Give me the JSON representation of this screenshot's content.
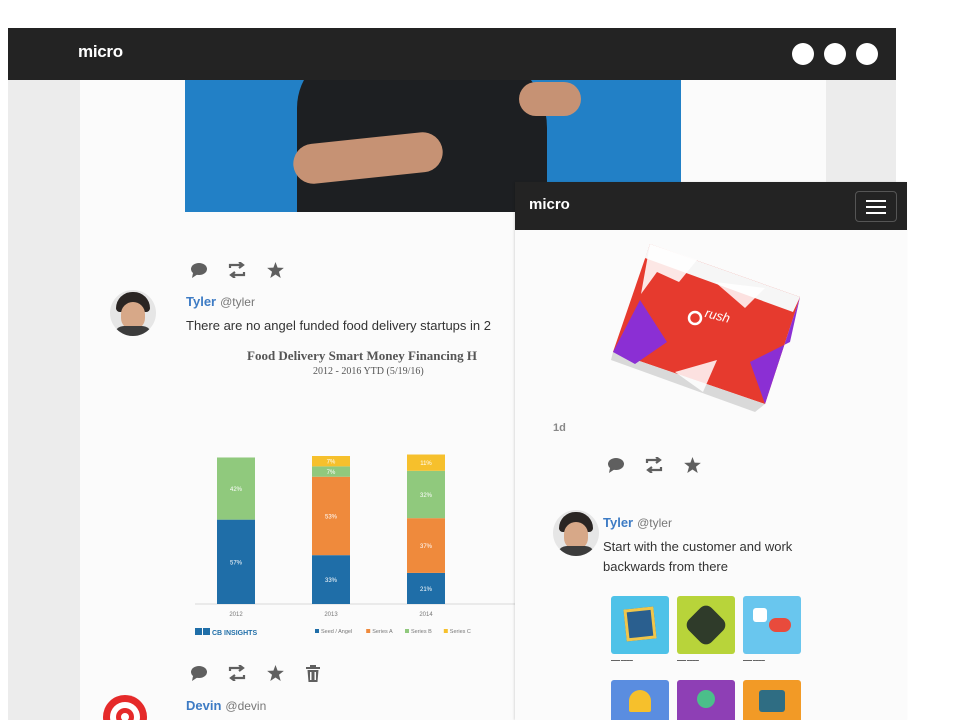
{
  "desktop": {
    "logo": "micro",
    "posts": [
      {
        "user": "Tyler",
        "handle": "@tyler",
        "text": "There are no angel funded food delivery startups in 2"
      },
      {
        "user": "Devin",
        "handle": "@devin"
      }
    ]
  },
  "mobile": {
    "logo": "micro",
    "time": "1d",
    "post": {
      "user": "Tyler",
      "handle": "@tyler",
      "text_line1": "Start with the customer and work",
      "text_line2": "backwards from there"
    },
    "product_label": "rush"
  },
  "colors": {
    "bar": "#232323",
    "link": "#3d7bc4",
    "seed": "#1f6ea8",
    "seriesA": "#ef8a3c",
    "seriesB": "#90c97d",
    "seriesC": "#f6c02c"
  },
  "chart_data": {
    "type": "bar",
    "title": "Food Delivery Smart Money Financing H",
    "subtitle": "2012 - 2016 YTD (5/19/16)",
    "categories": [
      "2012",
      "2013",
      "2014"
    ],
    "series": [
      {
        "name": "Seed / Angel",
        "values": [
          57,
          33,
          21
        ]
      },
      {
        "name": "Series A",
        "values": [
          0,
          53,
          37
        ]
      },
      {
        "name": "Series B",
        "values": [
          42,
          7,
          32
        ]
      },
      {
        "name": "Series C",
        "values": [
          0,
          7,
          11
        ]
      }
    ],
    "ylim": [
      0,
      100
    ],
    "legend": "bottom",
    "source": "CB INSIGHTS"
  }
}
